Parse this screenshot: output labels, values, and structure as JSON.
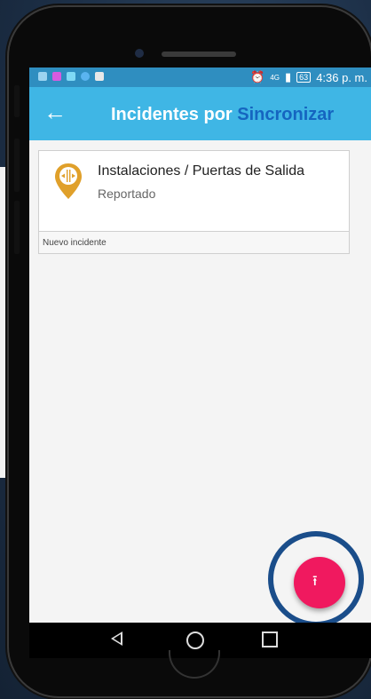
{
  "status_bar": {
    "time": "4:36 p. m.",
    "battery": "63",
    "network": "4G",
    "alarm_icon": "alarm-clock-icon"
  },
  "app_bar": {
    "title_part1": "Incidentes por",
    "title_part2": "Sincronizar",
    "back_icon": "arrow-left-icon"
  },
  "incident": {
    "title": "Instalaciones / Puertas de Salida",
    "status": "Reportado",
    "icon": "location-pin-door-icon"
  },
  "new_incident_label": "Nuevo incidente",
  "fab": {
    "icon": "upload-icon",
    "glyph": "⭱"
  },
  "nav": {
    "back_icon": "nav-back-icon",
    "home_icon": "nav-home-icon",
    "recent_icon": "nav-recent-apps-icon"
  },
  "colors": {
    "app_bar": "#3fb6e5",
    "title_highlight": "#1565c0",
    "fab": "#f0195f",
    "pin": "#e0a02a",
    "status_bar": "#2f8ec0"
  }
}
